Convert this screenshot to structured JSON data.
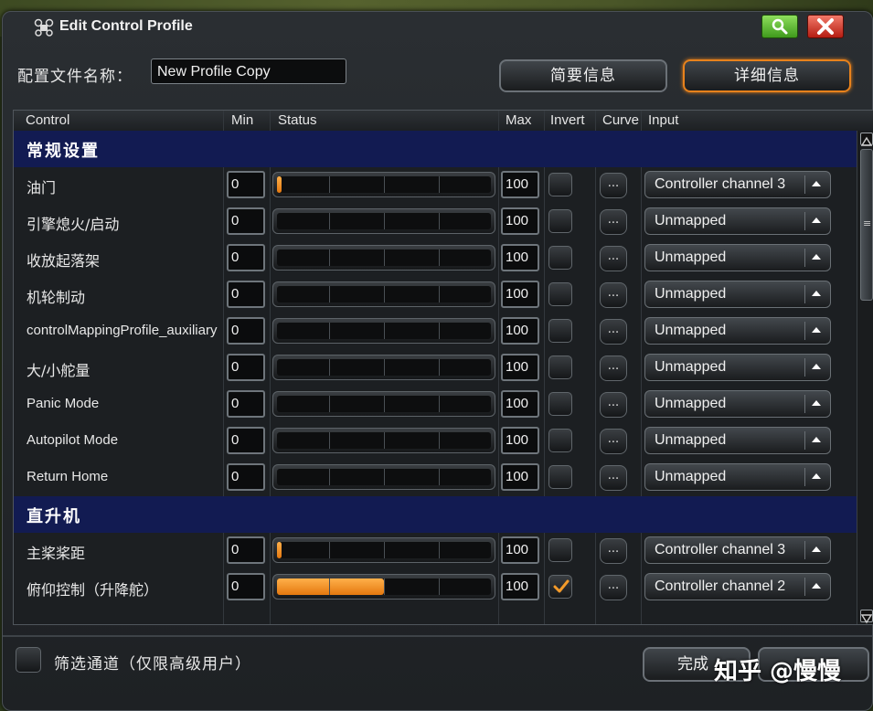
{
  "window": {
    "title": "Edit Control Profile"
  },
  "profile": {
    "name_label": "配置文件名称：",
    "name_value": "New Profile Copy"
  },
  "tabs": [
    {
      "label": "简要信息",
      "active": false
    },
    {
      "label": "详细信息",
      "active": true
    }
  ],
  "columns": {
    "control": "Control",
    "min": "Min",
    "status": "Status",
    "max": "Max",
    "invert": "Invert",
    "curve": "Curve",
    "input": "Input"
  },
  "sections": [
    {
      "title": "常规设置",
      "rows": [
        {
          "label": "油门",
          "min": "0",
          "max": "100",
          "fill": 0.02,
          "inverted": false,
          "curve": "...",
          "input": "Controller channel 3"
        },
        {
          "label": "引擎熄火/启动",
          "min": "0",
          "max": "100",
          "fill": 0,
          "inverted": false,
          "curve": "...",
          "input": "Unmapped"
        },
        {
          "label": "收放起落架",
          "min": "0",
          "max": "100",
          "fill": 0,
          "inverted": false,
          "curve": "...",
          "input": "Unmapped"
        },
        {
          "label": "机轮制动",
          "min": "0",
          "max": "100",
          "fill": 0,
          "inverted": false,
          "curve": "...",
          "input": "Unmapped"
        },
        {
          "label": "controlMappingProfile_auxiliary",
          "min": "0",
          "max": "100",
          "fill": 0,
          "inverted": false,
          "curve": "...",
          "input": "Unmapped"
        },
        {
          "label": "大/小舵量",
          "min": "0",
          "max": "100",
          "fill": 0,
          "inverted": false,
          "curve": "...",
          "input": "Unmapped"
        },
        {
          "label": "Panic Mode",
          "min": "0",
          "max": "100",
          "fill": 0,
          "inverted": false,
          "curve": "...",
          "input": "Unmapped"
        },
        {
          "label": "Autopilot Mode",
          "min": "0",
          "max": "100",
          "fill": 0,
          "inverted": false,
          "curve": "...",
          "input": "Unmapped"
        },
        {
          "label": "Return Home",
          "min": "0",
          "max": "100",
          "fill": 0,
          "inverted": false,
          "curve": "...",
          "input": "Unmapped"
        }
      ]
    },
    {
      "title": "直升机",
      "rows": [
        {
          "label": "主桨桨距",
          "min": "0",
          "max": "100",
          "fill": 0.02,
          "inverted": false,
          "curve": "...",
          "input": "Controller channel 3"
        },
        {
          "label": "俯仰控制（升降舵）",
          "min": "0",
          "max": "100",
          "fill": 0.5,
          "inverted": true,
          "curve": "...",
          "input": "Controller channel 2"
        }
      ]
    }
  ],
  "footer": {
    "filter_label": "筛选通道（仅限高级用户）",
    "done_label": "完成"
  },
  "watermark": "知乎 @慢慢",
  "colors": {
    "accent": "#e8821c",
    "section_bg": "#121b52",
    "close": "#c8281a",
    "search": "#5bb52f"
  }
}
